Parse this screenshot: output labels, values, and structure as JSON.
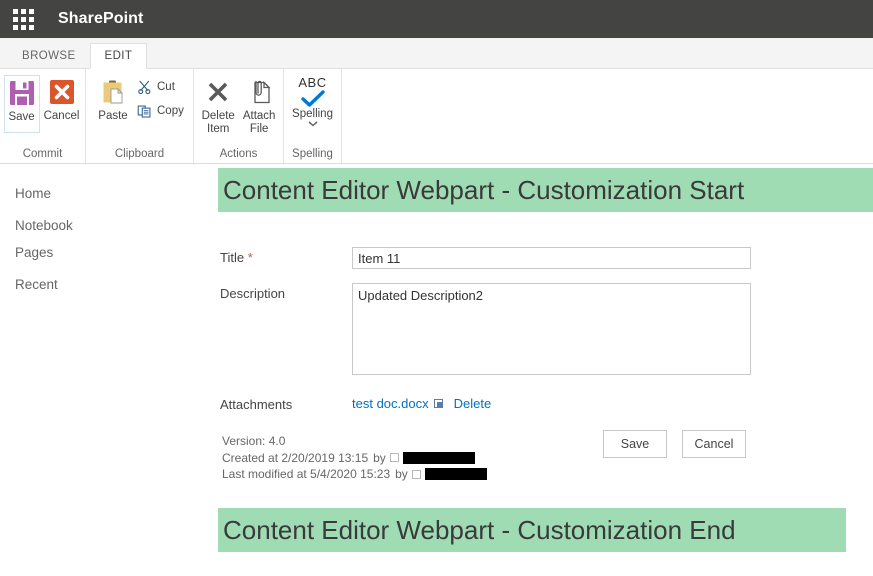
{
  "suite": {
    "waffle_icon": "app-launcher-waffle-icon",
    "title": "SharePoint"
  },
  "ribbon": {
    "tabs": [
      {
        "label": "BROWSE",
        "active": false
      },
      {
        "label": "EDIT",
        "active": true
      }
    ],
    "groups": [
      {
        "name": "Commit",
        "label": "Commit",
        "items": [
          {
            "label": "Save",
            "icon": "save-floppy-icon",
            "color": "#b05fb0",
            "selected": true
          },
          {
            "label": "Cancel",
            "icon": "cancel-x-icon",
            "color": "#d9552e",
            "selected": false
          }
        ]
      },
      {
        "name": "Clipboard",
        "label": "Clipboard",
        "items": [
          {
            "label": "Paste",
            "icon": "paste-clipboard-icon",
            "color": "#e8c170"
          },
          {
            "label": "Cut",
            "icon": "scissors-icon",
            "color": "#2b5c8a"
          },
          {
            "label": "Copy",
            "icon": "copy-pages-icon",
            "color": "#2b5c8a"
          }
        ]
      },
      {
        "name": "Actions",
        "label": "Actions",
        "items": [
          {
            "label": "Delete\nItem",
            "line1": "Delete",
            "line2": "Item",
            "icon": "delete-x-icon",
            "color": "#595959"
          },
          {
            "label": "Attach\nFile",
            "line1": "Attach",
            "line2": "File",
            "icon": "attach-file-icon",
            "color": "#595959"
          }
        ]
      },
      {
        "name": "Spelling",
        "label": "Spelling",
        "items": [
          {
            "label": "Spelling",
            "abc": "ABC",
            "icon": "spelling-check-icon",
            "color": "#0078d4",
            "has_dropdown": true
          }
        ]
      }
    ]
  },
  "left_nav": {
    "items": [
      {
        "label": "Home"
      },
      {
        "label": "Notebook"
      },
      {
        "label": "Pages"
      },
      {
        "label": "Recent"
      }
    ]
  },
  "content": {
    "banner_top": "Content Editor Webpart - Customization Start",
    "banner_bottom": "Content Editor Webpart - Customization End",
    "banner_color": "#9fdcb4",
    "form": {
      "title_label": "Title",
      "title_required_marker": "*",
      "title_value": "Item 11",
      "title_placeholder": "",
      "description_label": "Description",
      "description_value": "Updated Description2",
      "description_placeholder": "",
      "attachments_label": "Attachments",
      "attachment_file": "test doc.docx",
      "attachment_delete_label": "Delete",
      "save_button": "Save",
      "cancel_button": "Cancel"
    },
    "metadata": {
      "version_line": "Version: 4.0",
      "created_prefix": "Created at 2/20/2019 13:15",
      "created_by_label": "by",
      "created_by_name": "",
      "modified_prefix": "Last modified at 5/4/2020 15:23",
      "modified_by_label": "by",
      "modified_by_name": ""
    }
  }
}
